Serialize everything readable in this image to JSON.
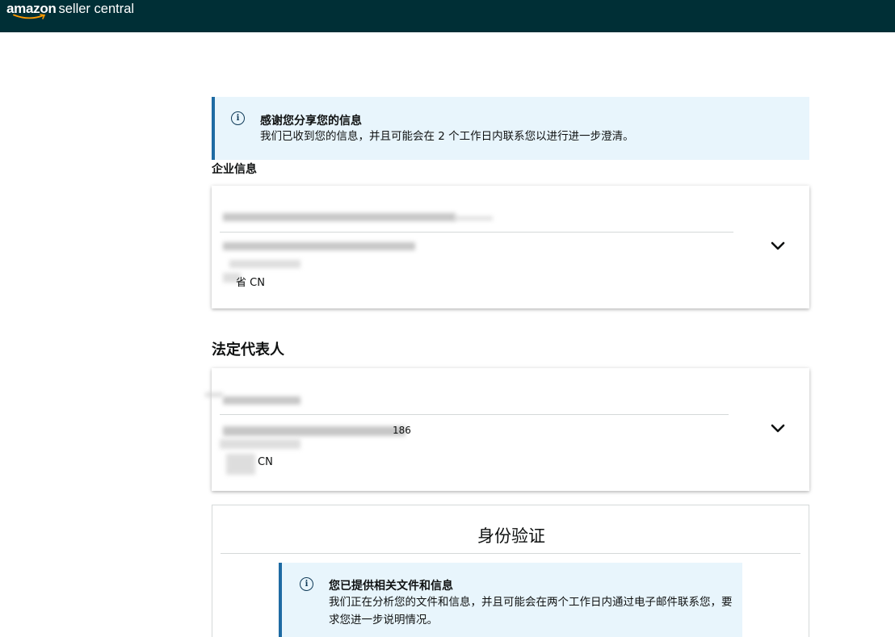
{
  "header": {
    "logo_brand": "amazon",
    "logo_rest": "seller central",
    "background_color": "#002f36"
  },
  "info_alert": {
    "icon": "info-icon",
    "title": "感谢您分享您的信息",
    "message": "我们已收到您的信息，并且可能会在 2 个工作日内联系您以进行进一步澄清。"
  },
  "business_info": {
    "title": "企业信息",
    "address_suffix": "省 CN"
  },
  "legal_rep": {
    "title": "法定代表人",
    "partial_text_1": "186",
    "address_suffix": "CN"
  },
  "identity_verification": {
    "title": "身份验证",
    "alert": {
      "icon": "info-icon",
      "title": "您已提供相关文件和信息",
      "message": "我们正在分析您的文件和信息，并且可能会在两个工作日内通过电子邮件联系您，要求您进一步说明情况。"
    }
  },
  "colors": {
    "alert_background": "#e8f5fc",
    "alert_border": "#1e6ba3",
    "amazon_smile": "#ff9900"
  }
}
